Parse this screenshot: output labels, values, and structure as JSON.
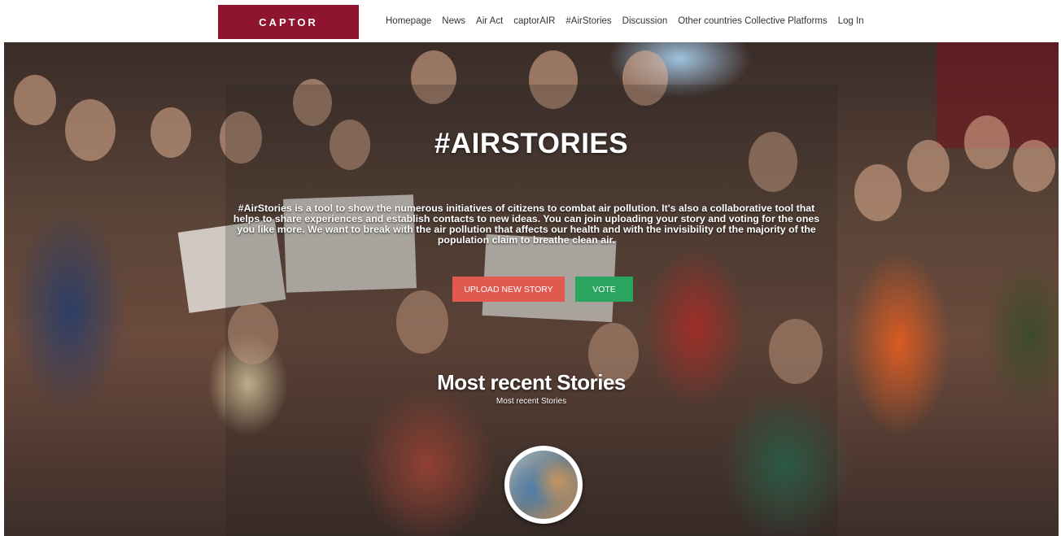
{
  "header": {
    "logo_text": "CAPTOR",
    "nav": [
      {
        "label": "Homepage"
      },
      {
        "label": "News"
      },
      {
        "label": "Air Act"
      },
      {
        "label": "captorAIR"
      },
      {
        "label": "#AirStories"
      },
      {
        "label": "Discussion"
      },
      {
        "label": "Other countries Collective Platforms"
      },
      {
        "label": "Log In"
      }
    ]
  },
  "hero": {
    "title": "#AIRSTORIES",
    "description": "#AirStories is a tool to show the numerous initiatives of citizens to combat air pollution. It's also a collaborative tool that helps to share experiences and establish contacts to new ideas. You can join uploading your story and voting for the ones you like more. We want to break with the air pollution that affects our health and with the invisibility of the majority of the population claim to breathe clean air.",
    "upload_button": "UPLOAD NEW STORY",
    "vote_button": "VOTE",
    "recent_title": "Most recent Stories",
    "recent_subtitle": "Most recent Stories"
  },
  "colors": {
    "brand": "#8e1430",
    "upload_button": "#e05a4f",
    "vote_button": "#2aa55f"
  }
}
